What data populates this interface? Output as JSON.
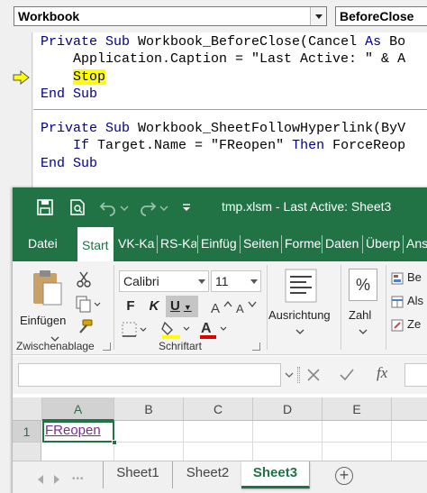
{
  "vbe": {
    "object_combo": "Workbook",
    "procedure_combo": "BeforeClose",
    "code": {
      "l1_kw": "Private Sub",
      "l1_rest": " Workbook_BeforeClose(Cancel ",
      "l1_kw2": "As",
      "l1_tail": " Bo",
      "l2": "    Application.Caption = \"Last Active: \" & A",
      "l3_stop": "Stop",
      "l4_kw": "End Sub",
      "l5_kw": "Private Sub",
      "l5_rest": " Workbook_SheetFollowHyperlink(ByV",
      "l6_kw": "If",
      "l6_mid": " Target.Name = \"FReopen\" ",
      "l6_kw2": "Then",
      "l6_tail": " ForceReop",
      "l7_kw": "End Sub"
    }
  },
  "excel": {
    "window_title": "tmp.xlsm  -  Last Active: Sheet3",
    "tabs": [
      "Datei",
      "Start",
      "VK-Ka",
      "RS-Ka",
      "Einfüg",
      "Seiten",
      "Forme",
      "Daten",
      "Überp",
      "Ans"
    ],
    "ribbon": {
      "paste_label": "Einfügen",
      "clipboard_group": "Zwischenablage",
      "font_name": "Calibri",
      "font_size": "11",
      "bold": "F",
      "italic": "K",
      "underline": "U",
      "font_group": "Schriftart",
      "alignment_label": "Ausrichtung",
      "number_label": "Zahl",
      "number_icon_text": "%",
      "styles_items": [
        "Be",
        "Als",
        "Ze"
      ]
    },
    "formula_bar": {
      "fx": "fx"
    },
    "grid": {
      "columns": [
        "A",
        "B",
        "C",
        "D",
        "E"
      ],
      "rows": [
        "1"
      ],
      "a1_value": "FReopen"
    },
    "sheets": [
      "Sheet1",
      "Sheet2",
      "Sheet3"
    ],
    "active_sheet": "Sheet3",
    "colors": {
      "excel_green": "#217346",
      "vba_keyword": "#00008b",
      "stop_highlight": "#ffff00",
      "hyperlink": "#7b2d8b"
    }
  }
}
